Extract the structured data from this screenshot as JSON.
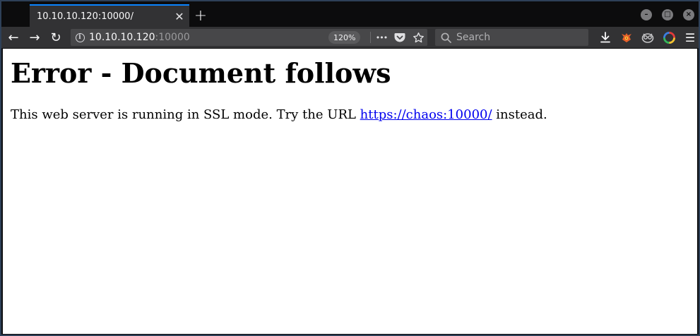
{
  "browser": {
    "tab": {
      "title": "10.10.10.120:10000/",
      "close_glyph": "✕"
    },
    "new_tab_glyph": "+",
    "window_controls": {
      "minimize": "–",
      "maximize": "□",
      "close": "×"
    },
    "nav": {
      "back_glyph": "←",
      "forward_glyph": "→",
      "reload_glyph": "↻"
    },
    "url": {
      "host": "10.10.10.120",
      "port": ":10000",
      "zoom": "120%"
    },
    "page_actions": {
      "more_glyph": "•••"
    },
    "search": {
      "placeholder": "Search"
    },
    "menu_glyph": "☰",
    "accent_color": "#0a84ff"
  },
  "page": {
    "heading": "Error - Document follows",
    "message_before": "This web server is running in SSL mode. Try the URL ",
    "link_text": "https://chaos:10000/",
    "message_after": " instead.",
    "link_color": "#0000ee"
  },
  "icons": [
    "back-arrow-icon",
    "forward-arrow-icon",
    "reload-icon",
    "info-icon",
    "more-icon",
    "pocket-icon",
    "bookmark-star-icon",
    "search-icon",
    "download-icon",
    "extension-fox-icon",
    "extension-owl-icon",
    "extension-circle-icon",
    "menu-icon"
  ]
}
